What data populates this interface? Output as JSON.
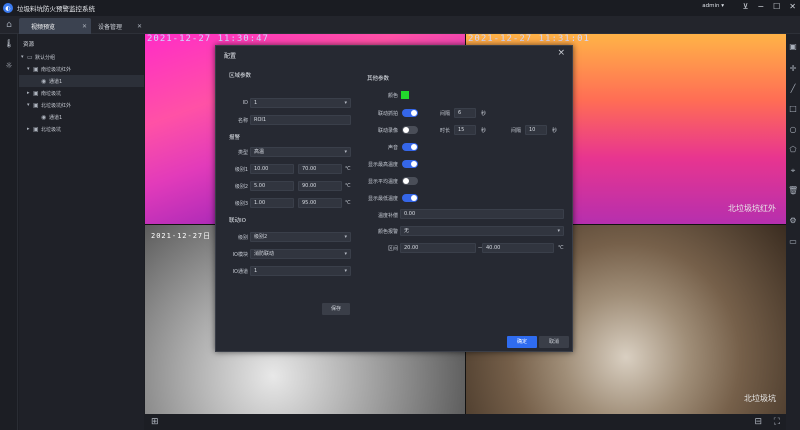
{
  "app": {
    "title": "垃圾料坑防火预警监控系统",
    "user": "admin"
  },
  "tabs": [
    {
      "label": "视频预览"
    },
    {
      "label": "设备管理"
    }
  ],
  "tree": {
    "header": "资源",
    "items": [
      {
        "label": "默认分组"
      },
      {
        "label": "南垃圾坑红外"
      },
      {
        "label": "通道1"
      },
      {
        "label": "南垃圾坑"
      },
      {
        "label": "北垃圾坑红外"
      },
      {
        "label": "通道1"
      },
      {
        "label": "北垃圾坑"
      }
    ]
  },
  "videos": {
    "v1_time": "2021-12-27 11:30:47",
    "v2_time": "2021-12-27 11:31:01",
    "v2_name": "北垃圾坑红外",
    "v3_time": "2021-12-27日",
    "v4_name": "北垃圾坑"
  },
  "dialog": {
    "title": "配置",
    "region_section": "区域参数",
    "id_label": "ID",
    "id_value": "1",
    "name_label": "名称",
    "name_value": "ROI1",
    "alarm_section": "报警",
    "type_label": "类型",
    "type_value": "高温",
    "level1_label": "级别1",
    "level1_low": "10.00",
    "level1_high": "70.00",
    "level2_label": "级别2",
    "level2_low": "5.00",
    "level2_high": "90.00",
    "level3_label": "级别3",
    "level3_low": "1.00",
    "level3_high": "95.00",
    "celsius": "℃",
    "io_section": "联动IO",
    "io_level_label": "级别",
    "io_level_value": "级别2",
    "io_module_label": "IO模块",
    "io_module_value": "消防联动",
    "io_channel_label": "IO通道",
    "io_channel_value": "1",
    "save_label": "保存",
    "special_section": "其他参数",
    "color_label": "颜色",
    "color_value": "#22d82c",
    "capture_label": "联动抓拍",
    "interval_label": "间隔",
    "capture_interval": "6",
    "sec": "秒",
    "record_label": "联动录像",
    "duration_label": "时长",
    "record_duration": "15",
    "record_interval_label": "间隔",
    "record_interval": "10",
    "sound_label": "声音",
    "show_max_label": "显示最高温度",
    "show_avg_label": "显示平均温度",
    "show_min_label": "显示最低温度",
    "temp_comp_label": "温度补偿",
    "temp_comp_value": "0.00",
    "color_alarm_label": "颜色报警",
    "color_alarm_value": "无",
    "range_label": "区间",
    "range_low": "20.00",
    "range_sep": "—",
    "range_high": "40.00",
    "ok_label": "确定",
    "cancel_label": "取消"
  }
}
